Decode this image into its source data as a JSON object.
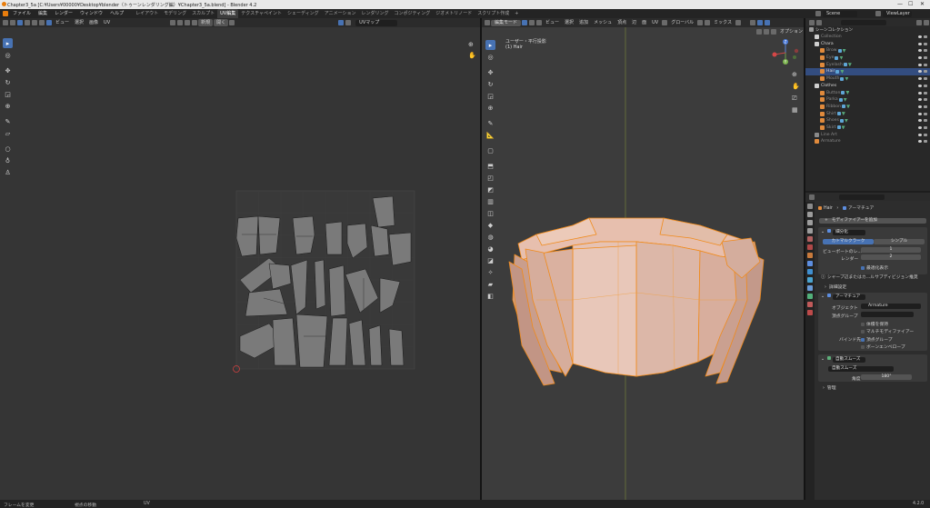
{
  "window": {
    "title": "Chapter3_5a [C:¥Users¥00000¥Desktop¥blender（トゥーンレンダリング編）¥Chapter3_5a.blend] - Blender 4.2",
    "controls": [
      "—",
      "☐",
      "✕"
    ]
  },
  "menu": {
    "items": [
      "ファイル",
      "編集",
      "レンダー",
      "ウィンドウ",
      "ヘルプ"
    ],
    "workspaces": [
      "レイアウト",
      "モデリング",
      "スカルプト",
      "UV編集",
      "テクスチャペイント",
      "シェーディング",
      "アニメーション",
      "レンダリング",
      "コンポジティング",
      "ジオメトリノード",
      "スクリプト作成"
    ],
    "active_workspace": "UV編集",
    "add_tab": "+"
  },
  "uv_editor": {
    "header": {
      "menus": [
        "ビュー",
        "選択",
        "画像",
        "UV"
      ],
      "new_button": "新規",
      "open_button": "開く",
      "uv_map": "UVマップ"
    }
  },
  "viewport": {
    "header": {
      "mode": "編集モード",
      "menus": [
        "ビュー",
        "選択",
        "追加",
        "メッシュ",
        "頂点",
        "辺",
        "面",
        "UV"
      ],
      "transform_orientation": "グローバル",
      "mix": "ミックス",
      "options": "オプション"
    },
    "info": {
      "view": "ユーザー・平行投影",
      "object": "(1) Hair"
    },
    "gizmo": {
      "x": "X",
      "y": "Y",
      "z": "Z"
    }
  },
  "topbar_right": {
    "scene": "Scene",
    "view_layer": "ViewLayer"
  },
  "outliner": {
    "search_placeholder": "",
    "rows": [
      {
        "name": "シーンコレクション",
        "indent": 0,
        "type": "scene",
        "dim": false,
        "sel": false
      },
      {
        "name": "Collection",
        "indent": 1,
        "type": "collection",
        "dim": true,
        "sel": false
      },
      {
        "name": "Chara",
        "indent": 1,
        "type": "collection",
        "dim": false,
        "sel": false
      },
      {
        "name": "Brow",
        "indent": 2,
        "type": "mesh",
        "dim": true,
        "sel": false
      },
      {
        "name": "Eye",
        "indent": 2,
        "type": "mesh",
        "dim": true,
        "sel": false
      },
      {
        "name": "Eyelash",
        "indent": 2,
        "type": "mesh",
        "dim": true,
        "sel": false
      },
      {
        "name": "Hair",
        "indent": 2,
        "type": "mesh",
        "dim": false,
        "sel": true
      },
      {
        "name": "Mouth",
        "indent": 2,
        "type": "mesh",
        "dim": true,
        "sel": false
      },
      {
        "name": "Clothes",
        "indent": 1,
        "type": "collection",
        "dim": false,
        "sel": false
      },
      {
        "name": "Button",
        "indent": 2,
        "type": "mesh",
        "dim": true,
        "sel": false
      },
      {
        "name": "Parka",
        "indent": 2,
        "type": "mesh",
        "dim": true,
        "sel": false
      },
      {
        "name": "Ribbon",
        "indent": 2,
        "type": "mesh",
        "dim": true,
        "sel": false
      },
      {
        "name": "Shirt",
        "indent": 2,
        "type": "mesh",
        "dim": true,
        "sel": false
      },
      {
        "name": "Shoes",
        "indent": 2,
        "type": "mesh",
        "dim": true,
        "sel": false
      },
      {
        "name": "Skirt",
        "indent": 2,
        "type": "mesh",
        "dim": true,
        "sel": false
      },
      {
        "name": "Line Art",
        "indent": 1,
        "type": "gp",
        "dim": true,
        "sel": false
      },
      {
        "name": "Armature",
        "indent": 1,
        "type": "armature",
        "dim": true,
        "sel": false
      }
    ]
  },
  "properties": {
    "breadcrumb_object": "Hair",
    "breadcrumb_sep": "›",
    "breadcrumb_modifier": "アーマチュア",
    "add_modifier": "モディファイアーを追加",
    "subsurf": {
      "name": "細分化",
      "tab_catmull": "カトマルクラーク",
      "tab_simple": "シンプル",
      "viewport_label": "ビューポートのレ...",
      "viewport_value": "1",
      "render_label": "レンダー",
      "render_value": "2",
      "optimal_display": "最適化表示",
      "warning": "シャープ辺またはカ...ルサブディビジョン推奨",
      "advanced": "詳細設定"
    },
    "armature": {
      "name": "アーマチュア",
      "object_label": "オブジェクト",
      "object_value": "Armature",
      "vertex_group_label": "頂点グループ",
      "preserve_volume": "体積を保持",
      "multi_modifier": "マルチモディファイアー",
      "bind_to_label": "バインド先",
      "bind_vertex_groups": "頂点グループ",
      "bind_bone_envelopes": "ボーンエンベロープ"
    },
    "smooth": {
      "name": "自動スムーズ",
      "node_group": "自動スムーズ",
      "angle_label": "角度",
      "angle_value": "180°",
      "manage": "管理"
    }
  },
  "statusbar": {
    "left": "フレームを変更",
    "mid": "視点の移動",
    "right": "UV",
    "version": "4.2.0"
  }
}
